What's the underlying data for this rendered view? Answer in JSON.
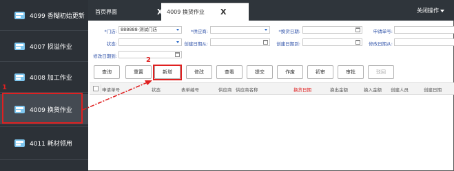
{
  "sidebar": {
    "items": [
      {
        "label": "4099 香糊初始更新"
      },
      {
        "label": "4007 损溢作业"
      },
      {
        "label": "4008 加工作业"
      },
      {
        "label": "4009 换货作业"
      },
      {
        "label": "4011 耗材领用"
      }
    ],
    "active_index": 3
  },
  "tabs": {
    "home_label": "首页界面",
    "home_close": "X",
    "active_label": "4009 换货作业",
    "active_close": "X",
    "close_ops": "关闭操作"
  },
  "form": {
    "store_label": "*门店:",
    "store_value": "888888-测试门店",
    "supplier_label": "*供应商:",
    "exchange_date_label": "*换货日期:",
    "application_no_label": "申请单号:",
    "status_label": "状态:",
    "created_from_label": "创建日期从:",
    "created_to_label": "创建日期到:",
    "modified_from_label": "修改日期从:",
    "modified_to_label": "修改日期到:"
  },
  "toolbar": {
    "query": "查询",
    "reset": "重置",
    "add": "新增",
    "edit": "修改",
    "view": "查看",
    "submit": "提交",
    "void": "作废",
    "first_review": "初审",
    "review": "审批",
    "reject": "驳回"
  },
  "table": {
    "headers": [
      "申请单号",
      "状态",
      "表单编号",
      "供应商",
      "供应商名称",
      "换货日期",
      "换出金额",
      "换入金额",
      "创建人员",
      "创建日期"
    ],
    "highlight_header": "换货日期"
  },
  "annotations": {
    "step1": "1",
    "step2": "2"
  },
  "colors": {
    "sidebar_bg": "#2c3137",
    "annotation_red": "#e02020",
    "label_blue": "#3355aa"
  }
}
